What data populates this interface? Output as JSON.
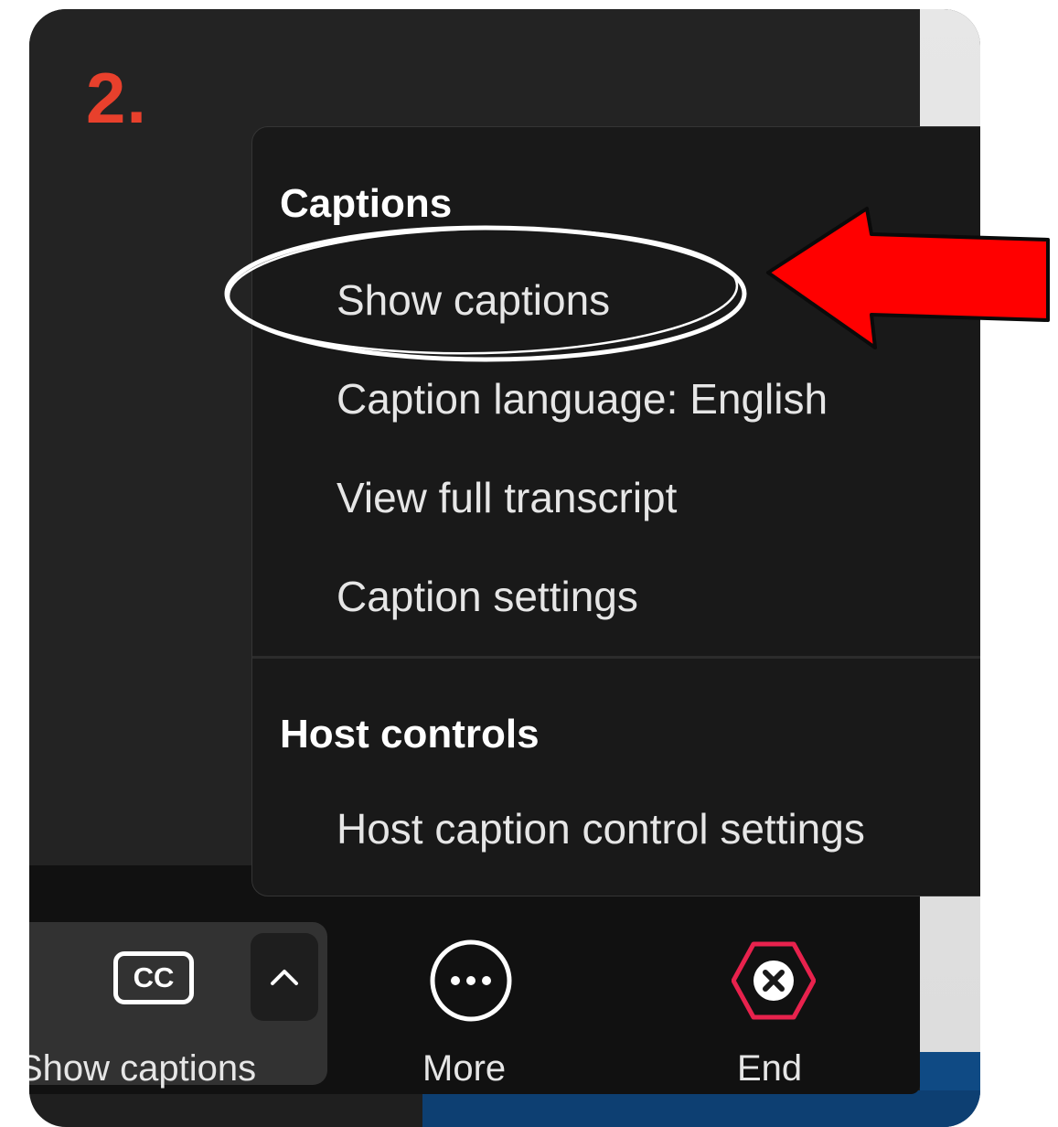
{
  "step_label": "2.",
  "menu": {
    "section_captions": "Captions",
    "items": [
      "Show captions",
      "Caption language: English",
      "View full transcript",
      "Caption settings"
    ],
    "section_host": "Host controls",
    "host_items": [
      "Host caption control settings"
    ]
  },
  "toolbar": {
    "cc_icon_text": "CC",
    "show_captions_label": "Show captions",
    "more_label": "More",
    "end_label": "End"
  },
  "icons": {
    "cc": "closed-captions-icon",
    "caret": "chevron-up-icon",
    "more": "ellipsis-circle-icon",
    "end": "close-hexagon-icon",
    "arrow": "red-arrow-annotation"
  },
  "colors": {
    "step": "#e8402c",
    "end_accent": "#e8224d",
    "arrow": "#ff0000",
    "menu_bg": "#191919"
  }
}
